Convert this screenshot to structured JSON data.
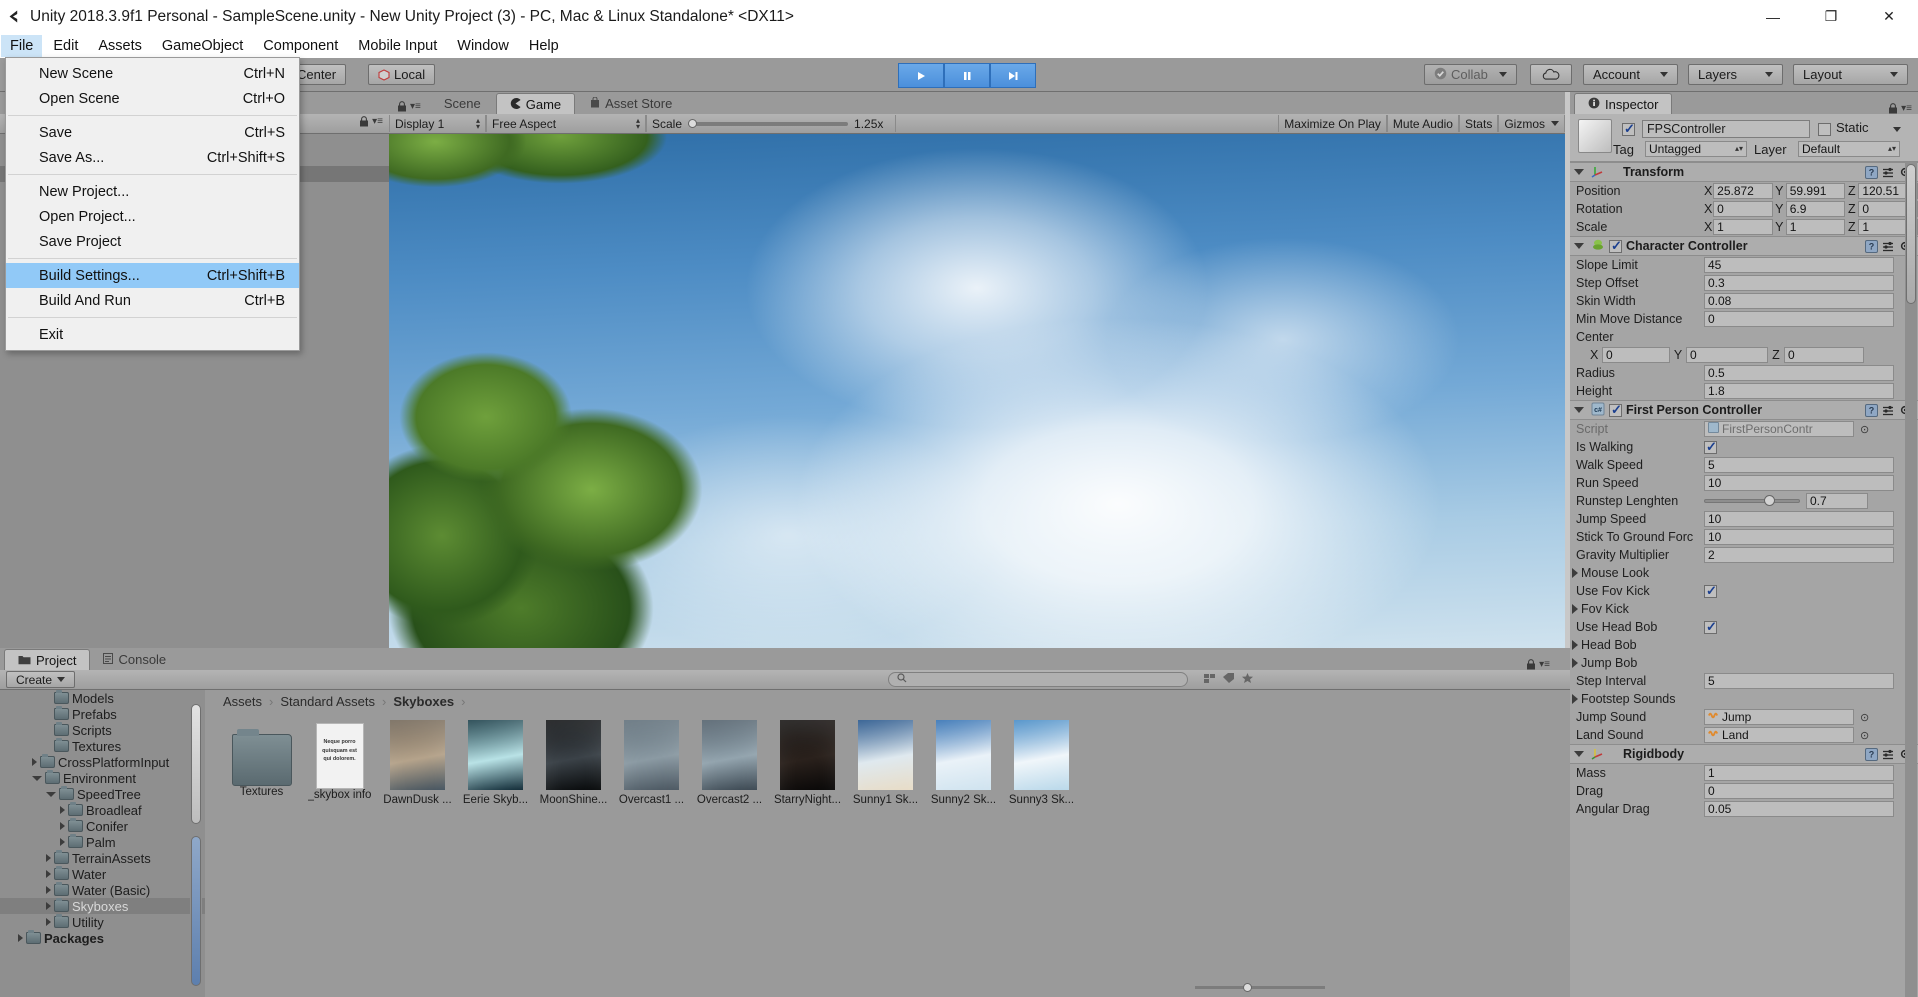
{
  "window": {
    "title": "Unity 2018.3.9f1 Personal - SampleScene.unity - New Unity Project (3) - PC, Mac & Linux Standalone* <DX11>",
    "minimize": "—",
    "maximize": "❐",
    "close": "✕"
  },
  "menubar": {
    "items": [
      {
        "label": "File",
        "active": true
      },
      {
        "label": "Edit",
        "active": false
      },
      {
        "label": "Assets",
        "active": false
      },
      {
        "label": "GameObject",
        "active": false
      },
      {
        "label": "Component",
        "active": false
      },
      {
        "label": "Mobile Input",
        "active": false
      },
      {
        "label": "Window",
        "active": false
      },
      {
        "label": "Help",
        "active": false
      }
    ]
  },
  "file_menu": {
    "groups": [
      [
        {
          "label": "New Scene",
          "accel": "Ctrl+N",
          "highlight": false
        },
        {
          "label": "Open Scene",
          "accel": "Ctrl+O",
          "highlight": false
        }
      ],
      [
        {
          "label": "Save",
          "accel": "Ctrl+S",
          "highlight": false
        },
        {
          "label": "Save As...",
          "accel": "Ctrl+Shift+S",
          "highlight": false
        }
      ],
      [
        {
          "label": "New Project...",
          "accel": "",
          "highlight": false
        },
        {
          "label": "Open Project...",
          "accel": "",
          "highlight": false
        },
        {
          "label": "Save Project",
          "accel": "",
          "highlight": false
        }
      ],
      [
        {
          "label": "Build Settings...",
          "accel": "Ctrl+Shift+B",
          "highlight": true
        },
        {
          "label": "Build And Run",
          "accel": "Ctrl+B",
          "highlight": false
        }
      ],
      [
        {
          "label": "Exit",
          "accel": "",
          "highlight": false
        }
      ]
    ]
  },
  "toolbar": {
    "pivot_label": "Center",
    "local_label": "Local",
    "play": "▶",
    "pause": "‖",
    "step": "▶|",
    "collab_label": "Collab",
    "cloud_label": "☁",
    "account_label": "Account",
    "layers_label": "Layers",
    "layout_label": "Layout"
  },
  "gameview": {
    "tabs": [
      {
        "label": "Scene",
        "selected": false,
        "icon": ""
      },
      {
        "label": "Game",
        "selected": true,
        "icon": "game-icon"
      },
      {
        "label": "Asset Store",
        "selected": false,
        "icon": "store-icon"
      }
    ],
    "display": "Display 1",
    "aspect": "Free Aspect",
    "scale_label": "Scale",
    "scale_value": "1.25x",
    "maximize_on_play": "Maximize On Play",
    "mute_audio": "Mute Audio",
    "stats": "Stats",
    "gizmos": "Gizmos"
  },
  "inspector": {
    "tab_label": "Inspector",
    "object_name": "FPSController",
    "object_enabled": true,
    "static_label": "Static",
    "static_checked": false,
    "tag_label": "Tag",
    "tag_value": "Untagged",
    "layer_label": "Layer",
    "layer_value": "Default",
    "components": [
      {
        "name": "Transform",
        "has_enable_checkbox": false,
        "enabled": true,
        "expanded": true,
        "vector_rows": [
          {
            "label": "Position",
            "x": "25.872",
            "y": "59.991",
            "z": "120.51"
          },
          {
            "label": "Rotation",
            "x": "0",
            "y": "6.9",
            "z": "0"
          },
          {
            "label": "Scale",
            "x": "1",
            "y": "1",
            "z": "1"
          }
        ],
        "rows": []
      },
      {
        "name": "Character Controller",
        "has_enable_checkbox": true,
        "enabled": true,
        "expanded": true,
        "rows": [
          {
            "label": "Slope Limit",
            "value": "45",
            "type": "field"
          },
          {
            "label": "Step Offset",
            "value": "0.3",
            "type": "field"
          },
          {
            "label": "Skin Width",
            "value": "0.08",
            "type": "field"
          },
          {
            "label": "Min Move Distance",
            "value": "0",
            "type": "field"
          },
          {
            "label": "Center",
            "value": "",
            "type": "label"
          }
        ],
        "center_vector": {
          "x": "0",
          "y": "0",
          "z": "0"
        },
        "rows_after": [
          {
            "label": "Radius",
            "value": "0.5",
            "type": "field"
          },
          {
            "label": "Height",
            "value": "1.8",
            "type": "field"
          }
        ]
      },
      {
        "name": "First Person Controller",
        "has_enable_checkbox": true,
        "enabled": true,
        "expanded": true,
        "rows": [
          {
            "label": "Script",
            "value": "FirstPersonContr",
            "type": "object",
            "dim": true
          },
          {
            "label": "Is Walking",
            "value": "",
            "type": "checkbox",
            "checked": true
          },
          {
            "label": "Walk Speed",
            "value": "5",
            "type": "field"
          },
          {
            "label": "Run Speed",
            "value": "10",
            "type": "field"
          },
          {
            "label": "Runstep Lenghten",
            "value": "0.7",
            "type": "slider",
            "slider_pct": 62
          },
          {
            "label": "Jump Speed",
            "value": "10",
            "type": "field"
          },
          {
            "label": "Stick To Ground Forc",
            "value": "10",
            "type": "field"
          },
          {
            "label": "Gravity Multiplier",
            "value": "2",
            "type": "field"
          },
          {
            "label": "Mouse Look",
            "value": "",
            "type": "foldout"
          },
          {
            "label": "Use Fov Kick",
            "value": "",
            "type": "checkbox",
            "checked": true
          },
          {
            "label": "Fov Kick",
            "value": "",
            "type": "foldout"
          },
          {
            "label": "Use Head Bob",
            "value": "",
            "type": "checkbox",
            "checked": true
          },
          {
            "label": "Head Bob",
            "value": "",
            "type": "foldout"
          },
          {
            "label": "Jump Bob",
            "value": "",
            "type": "foldout"
          },
          {
            "label": "Step Interval",
            "value": "5",
            "type": "field"
          },
          {
            "label": "Footstep Sounds",
            "value": "",
            "type": "foldout"
          },
          {
            "label": "Jump Sound",
            "value": "Jump",
            "type": "object"
          },
          {
            "label": "Land Sound",
            "value": "Land",
            "type": "object"
          }
        ]
      },
      {
        "name": "Rigidbody",
        "has_enable_checkbox": false,
        "enabled": true,
        "expanded": true,
        "rows": [
          {
            "label": "Mass",
            "value": "1",
            "type": "field"
          },
          {
            "label": "Drag",
            "value": "0",
            "type": "field"
          },
          {
            "label": "Angular Drag",
            "value": "0.05",
            "type": "field"
          }
        ]
      }
    ]
  },
  "project": {
    "tabs": [
      {
        "label": "Project",
        "selected": true,
        "icon": "folder-icon"
      },
      {
        "label": "Console",
        "selected": false,
        "icon": "console-icon"
      }
    ],
    "create_label": "Create",
    "search_placeholder": "",
    "tree": [
      {
        "label": "Models",
        "depth": 3,
        "arrow": "none",
        "selected": false
      },
      {
        "label": "Prefabs",
        "depth": 3,
        "arrow": "none",
        "selected": false
      },
      {
        "label": "Scripts",
        "depth": 3,
        "arrow": "none",
        "selected": false
      },
      {
        "label": "Textures",
        "depth": 3,
        "arrow": "none",
        "selected": false
      },
      {
        "label": "CrossPlatformInput",
        "depth": 2,
        "arrow": "closed",
        "selected": false
      },
      {
        "label": "Environment",
        "depth": 2,
        "arrow": "open",
        "selected": false
      },
      {
        "label": "SpeedTree",
        "depth": 3,
        "arrow": "open",
        "selected": false
      },
      {
        "label": "Broadleaf",
        "depth": 4,
        "arrow": "closed",
        "selected": false
      },
      {
        "label": "Conifer",
        "depth": 4,
        "arrow": "closed",
        "selected": false
      },
      {
        "label": "Palm",
        "depth": 4,
        "arrow": "closed",
        "selected": false
      },
      {
        "label": "TerrainAssets",
        "depth": 3,
        "arrow": "closed",
        "selected": false
      },
      {
        "label": "Water",
        "depth": 3,
        "arrow": "closed",
        "selected": false
      },
      {
        "label": "Water (Basic)",
        "depth": 3,
        "arrow": "closed",
        "selected": false
      },
      {
        "label": "Skyboxes",
        "depth": 3,
        "arrow": "closed",
        "selected": true
      },
      {
        "label": "Utility",
        "depth": 3,
        "arrow": "closed",
        "selected": false
      },
      {
        "label": "Packages",
        "depth": 1,
        "arrow": "closed",
        "selected": false,
        "bold": true
      }
    ],
    "breadcrumb": [
      "Assets",
      "Standard Assets",
      "Skyboxes"
    ],
    "items": [
      {
        "label": "Textures",
        "kind": "folder"
      },
      {
        "label": "_skybox info",
        "kind": "doc",
        "doc_text": "Neque porro quisquam est qui dolorem."
      },
      {
        "label": "DawnDusk ...",
        "kind": "tex",
        "c1": "#6d6152",
        "c2": "#b5a38b",
        "c3": "#43525e"
      },
      {
        "label": "Eerie Skyb...",
        "kind": "tex",
        "c1": "#123742",
        "c2": "#b8e2e6",
        "c3": "#0d2733"
      },
      {
        "label": "MoonShine...",
        "kind": "tex",
        "c1": "#0a0c0e",
        "c2": "#3b4248",
        "c3": "#060809"
      },
      {
        "label": "Overcast1 ...",
        "kind": "tex",
        "c1": "#5a6a75",
        "c2": "#8b9aa3",
        "c3": "#49555f"
      },
      {
        "label": "Overcast2 ...",
        "kind": "tex",
        "c1": "#4b5a66",
        "c2": "#93a4ae",
        "c3": "#39454f"
      },
      {
        "label": "StarryNight...",
        "kind": "tex",
        "c1": "#100d0c",
        "c2": "#2a211c",
        "c3": "#080707"
      },
      {
        "label": "Sunny1 Sk...",
        "kind": "tex",
        "c1": "#1d4e86",
        "c2": "#dfe9ef",
        "c3": "#e8dcc6"
      },
      {
        "label": "Sunny2 Sk...",
        "kind": "tex",
        "c1": "#2a6bb0",
        "c2": "#eaf2f8",
        "c3": "#cfe3ef"
      },
      {
        "label": "Sunny3 Sk...",
        "kind": "tex",
        "c1": "#3f87c4",
        "c2": "#f0f6fa",
        "c3": "#b9d8ea"
      }
    ]
  }
}
